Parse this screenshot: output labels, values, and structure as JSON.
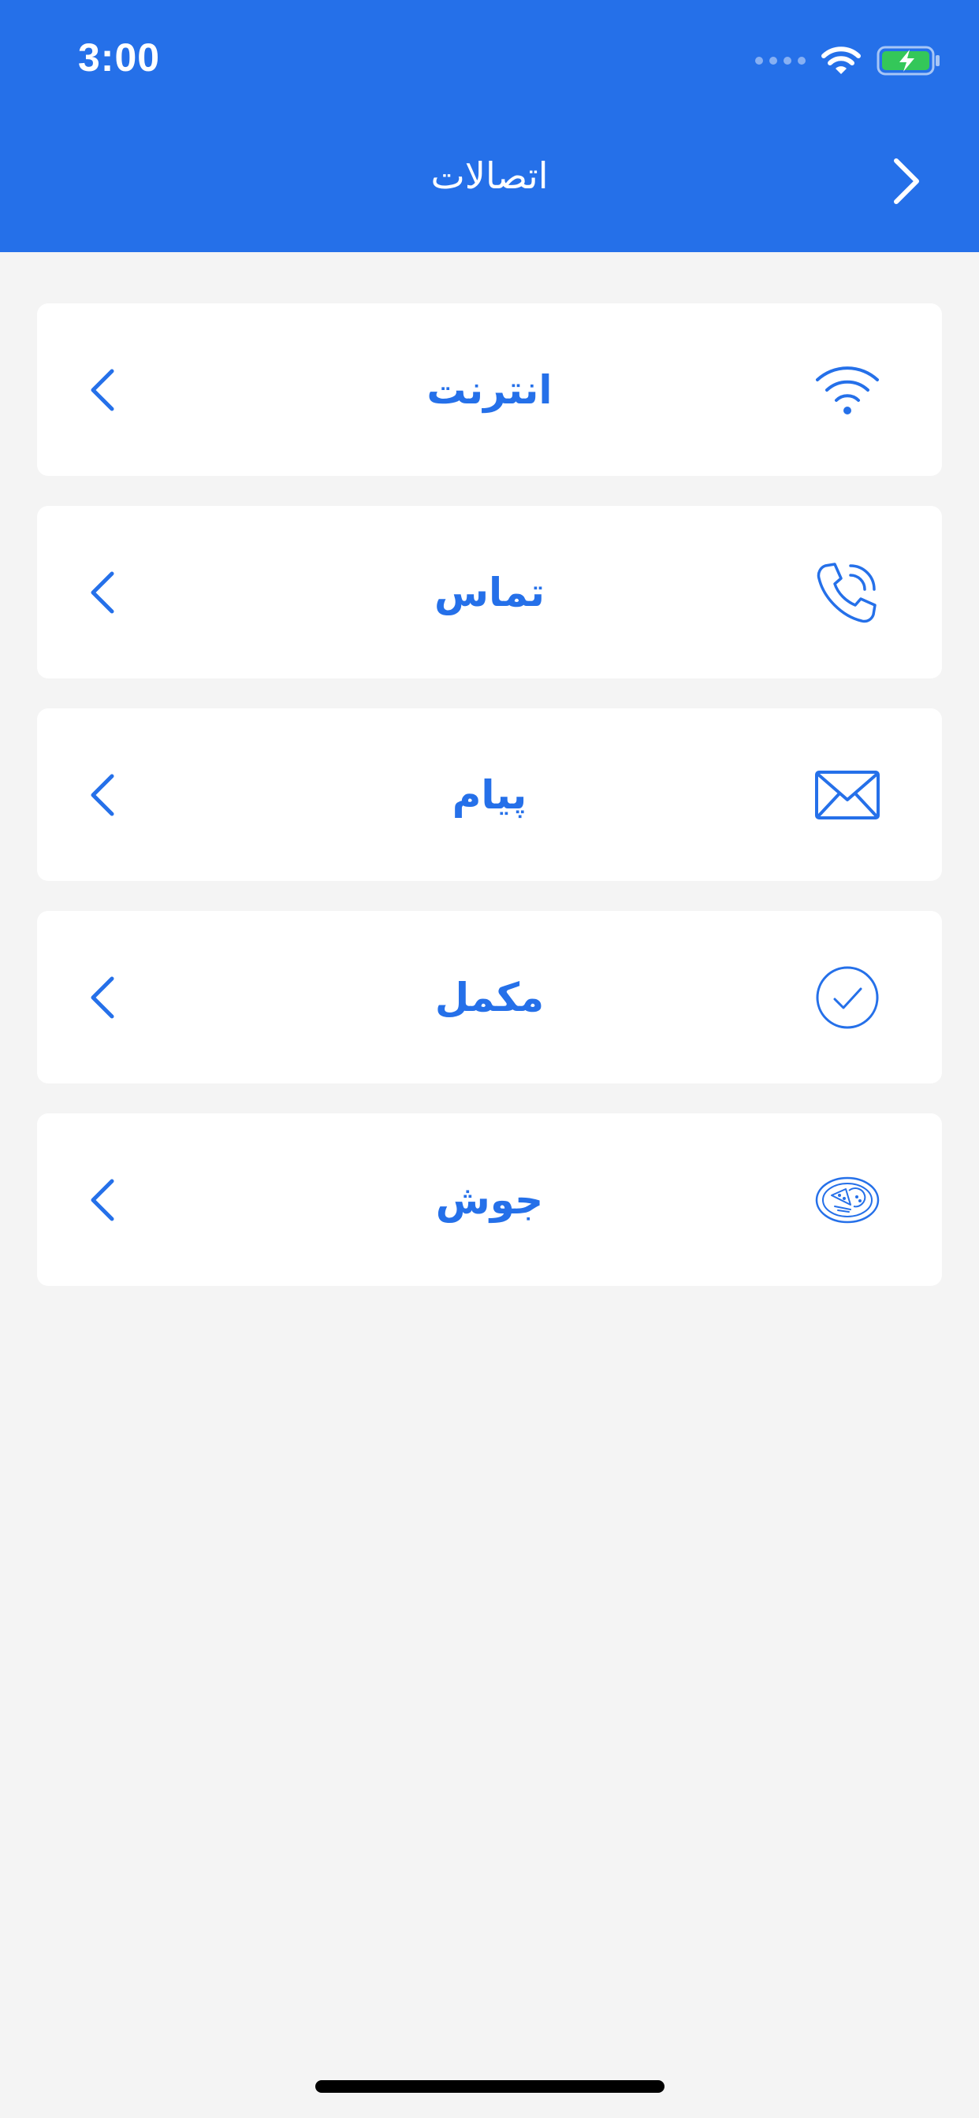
{
  "status_bar": {
    "time": "3:00"
  },
  "header": {
    "title": "اتصالات",
    "background": "#2570e9"
  },
  "accent_color": "#2570e9",
  "items": [
    {
      "label": "انترنت",
      "icon": "wifi-icon"
    },
    {
      "label": "تماس",
      "icon": "phone-icon"
    },
    {
      "label": "پیام",
      "icon": "envelope-icon"
    },
    {
      "label": "مکمل",
      "icon": "check-circle-icon"
    },
    {
      "label": "جوش",
      "icon": "food-plate-icon"
    }
  ]
}
